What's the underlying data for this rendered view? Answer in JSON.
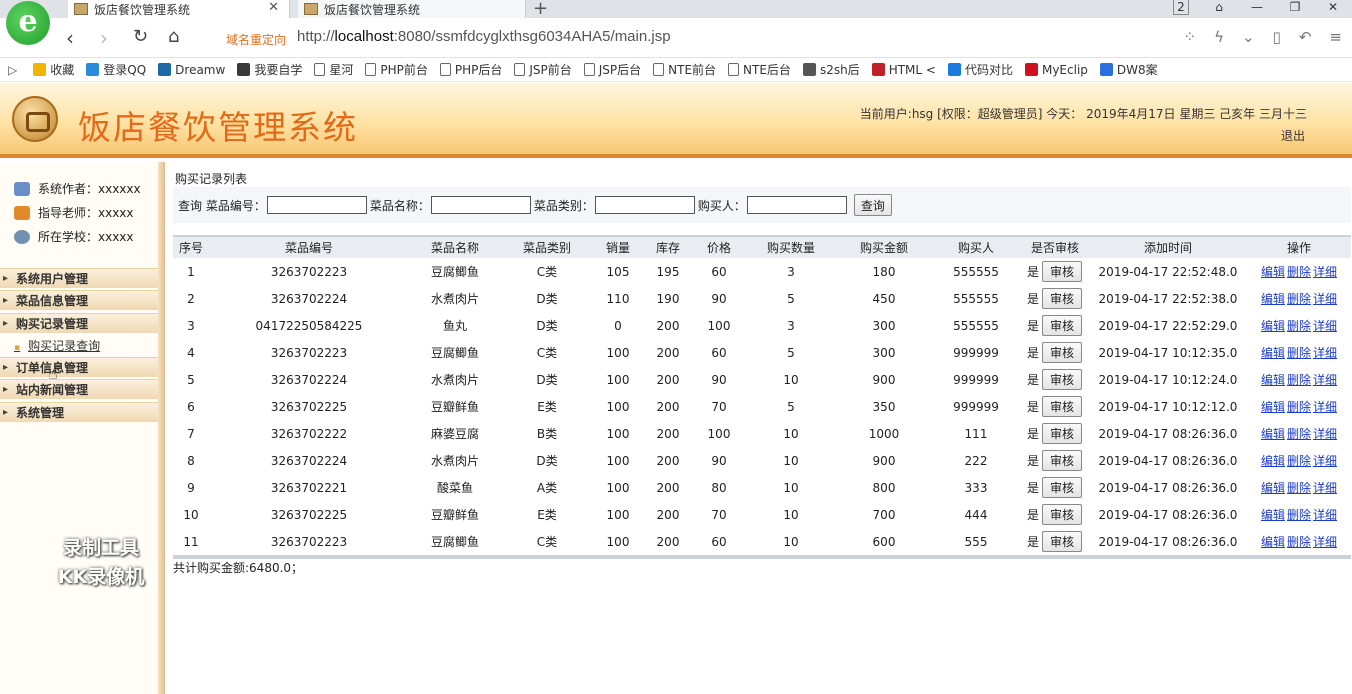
{
  "browser": {
    "logo_letter": "e",
    "tabs": [
      {
        "title": "饭店餐饮管理系统",
        "active": true
      },
      {
        "title": "饭店餐饮管理系统",
        "active": false
      }
    ],
    "tab_count": "2",
    "redirect_label": "域名重定向",
    "url_prefix": "http://",
    "url_host": "localhost",
    "url_rest": ":8080/ssmfdcyglxthsg6034AHA5/main.jsp",
    "bookmarks": [
      {
        "label": "收藏",
        "icon": "star-icon",
        "color": "#f2b400"
      },
      {
        "label": "登录QQ",
        "icon": "qq-icon",
        "color": "#2a8cd8"
      },
      {
        "label": "Dreamw",
        "icon": "dreamweaver-icon",
        "color": "#1b6aa8"
      },
      {
        "label": "我要自学",
        "icon": "book-icon",
        "color": "#3a3a3a"
      },
      {
        "label": "星河",
        "icon": "page-icon",
        "color": ""
      },
      {
        "label": "PHP前台",
        "icon": "page-icon",
        "color": ""
      },
      {
        "label": "PHP后台",
        "icon": "page-icon",
        "color": ""
      },
      {
        "label": "JSP前台",
        "icon": "page-icon",
        "color": ""
      },
      {
        "label": "JSP后台",
        "icon": "page-icon",
        "color": ""
      },
      {
        "label": "NTE前台",
        "icon": "page-icon",
        "color": ""
      },
      {
        "label": "NTE后台",
        "icon": "page-icon",
        "color": ""
      },
      {
        "label": "s2sh后",
        "icon": "image-icon",
        "color": "#555555"
      },
      {
        "label": "HTML <",
        "icon": "html-icon",
        "color": "#c0202a"
      },
      {
        "label": "代码对比",
        "icon": "compare-icon",
        "color": "#1a7ae0"
      },
      {
        "label": "MyEclip",
        "icon": "myeclipse-icon",
        "color": "#d01020"
      },
      {
        "label": "DW8案",
        "icon": "paw-icon",
        "color": "#2a6ee0"
      }
    ]
  },
  "header": {
    "title": "饭店餐饮管理系统",
    "user_info": "当前用户:hsg [权限：超级管理员] 今天： 2019年4月17日 星期三 己亥年 三月十三",
    "logout": "退出"
  },
  "sidebar": {
    "info": [
      {
        "label": "系统作者：xxxxxx",
        "icon": "people-icon",
        "color": "#6a8fc8"
      },
      {
        "label": "指导老师：xxxxx",
        "icon": "teacher-icon",
        "color": "#e08a2a"
      },
      {
        "label": "所在学校：xxxxx",
        "icon": "school-icon",
        "color": "#7090b0"
      }
    ],
    "menus": [
      {
        "label": "系统用户管理"
      },
      {
        "label": "菜品信息管理"
      },
      {
        "label": "购买记录管理"
      },
      {
        "label": "订单信息管理"
      },
      {
        "label": "站内新闻管理"
      },
      {
        "label": "系统管理"
      }
    ],
    "submenu": "购买记录查询"
  },
  "watermark": {
    "line1": "录制工具",
    "line2": "KK录像机"
  },
  "main": {
    "section_title": "购买记录列表",
    "search": {
      "prefix": "查询",
      "dish_code_label": "菜品编号：",
      "dish_name_label": "菜品名称：",
      "dish_type_label": "菜品类别：",
      "buyer_label": "购买人：",
      "button": "查询"
    },
    "columns": [
      "序号",
      "菜品编号",
      "菜品名称",
      "菜品类别",
      "销量",
      "库存",
      "价格",
      "购买数量",
      "购买金额",
      "购买人",
      "是否审核",
      "添加时间",
      "操作"
    ],
    "rows": [
      {
        "no": "1",
        "code": "3263702223",
        "name": "豆腐鲫鱼",
        "type": "C类",
        "sales": "105",
        "stock": "195",
        "price": "60",
        "qty": "3",
        "amount": "180",
        "buyer": "555555",
        "audited": "是",
        "time": "2019-04-17 22:52:48.0"
      },
      {
        "no": "2",
        "code": "3263702224",
        "name": "水煮肉片",
        "type": "D类",
        "sales": "110",
        "stock": "190",
        "price": "90",
        "qty": "5",
        "amount": "450",
        "buyer": "555555",
        "audited": "是",
        "time": "2019-04-17 22:52:38.0"
      },
      {
        "no": "3",
        "code": "04172250584225",
        "name": "鱼丸",
        "type": "D类",
        "sales": "0",
        "stock": "200",
        "price": "100",
        "qty": "3",
        "amount": "300",
        "buyer": "555555",
        "audited": "是",
        "time": "2019-04-17 22:52:29.0"
      },
      {
        "no": "4",
        "code": "3263702223",
        "name": "豆腐鲫鱼",
        "type": "C类",
        "sales": "100",
        "stock": "200",
        "price": "60",
        "qty": "5",
        "amount": "300",
        "buyer": "999999",
        "audited": "是",
        "time": "2019-04-17 10:12:35.0"
      },
      {
        "no": "5",
        "code": "3263702224",
        "name": "水煮肉片",
        "type": "D类",
        "sales": "100",
        "stock": "200",
        "price": "90",
        "qty": "10",
        "amount": "900",
        "buyer": "999999",
        "audited": "是",
        "time": "2019-04-17 10:12:24.0"
      },
      {
        "no": "6",
        "code": "3263702225",
        "name": "豆瓣鲜鱼",
        "type": "E类",
        "sales": "100",
        "stock": "200",
        "price": "70",
        "qty": "5",
        "amount": "350",
        "buyer": "999999",
        "audited": "是",
        "time": "2019-04-17 10:12:12.0"
      },
      {
        "no": "7",
        "code": "3263702222",
        "name": "麻婆豆腐",
        "type": "B类",
        "sales": "100",
        "stock": "200",
        "price": "100",
        "qty": "10",
        "amount": "1000",
        "buyer": "111",
        "audited": "是",
        "time": "2019-04-17 08:26:36.0"
      },
      {
        "no": "8",
        "code": "3263702224",
        "name": "水煮肉片",
        "type": "D类",
        "sales": "100",
        "stock": "200",
        "price": "90",
        "qty": "10",
        "amount": "900",
        "buyer": "222",
        "audited": "是",
        "time": "2019-04-17 08:26:36.0"
      },
      {
        "no": "9",
        "code": "3263702221",
        "name": "酸菜鱼",
        "type": "A类",
        "sales": "100",
        "stock": "200",
        "price": "80",
        "qty": "10",
        "amount": "800",
        "buyer": "333",
        "audited": "是",
        "time": "2019-04-17 08:26:36.0"
      },
      {
        "no": "10",
        "code": "3263702225",
        "name": "豆瓣鲜鱼",
        "type": "E类",
        "sales": "100",
        "stock": "200",
        "price": "70",
        "qty": "10",
        "amount": "700",
        "buyer": "444",
        "audited": "是",
        "time": "2019-04-17 08:26:36.0"
      },
      {
        "no": "11",
        "code": "3263702223",
        "name": "豆腐鲫鱼",
        "type": "C类",
        "sales": "100",
        "stock": "200",
        "price": "60",
        "qty": "10",
        "amount": "600",
        "buyer": "555",
        "audited": "是",
        "time": "2019-04-17 08:26:36.0"
      }
    ],
    "audit_button": "审核",
    "ops": {
      "edit": "编辑",
      "delete": "删除",
      "detail": "详细"
    },
    "total": "共计购买金额:6480.0；"
  }
}
